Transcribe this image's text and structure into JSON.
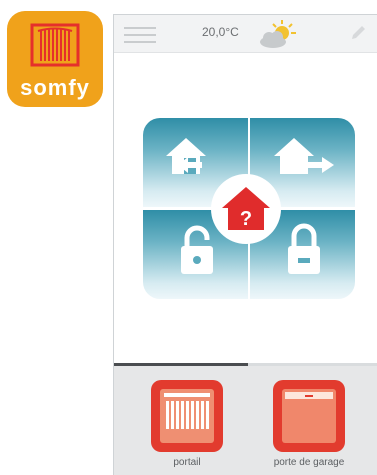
{
  "app": {
    "brand": "somfy",
    "brand_color": "#f0a21b"
  },
  "header": {
    "temperature": "20,0°C",
    "weather_icon": "partly-cloudy-sun-icon"
  },
  "control_pad": {
    "quadrants": [
      {
        "name": "leave-home",
        "icon": "house-arrow-left-icon"
      },
      {
        "name": "come-home",
        "icon": "house-arrow-right-icon"
      },
      {
        "name": "unlocked",
        "icon": "unlocked-padlock-icon"
      },
      {
        "name": "locked",
        "icon": "locked-padlock-icon"
      }
    ],
    "center_symbol": "?",
    "accent_color": "#e02c2c"
  },
  "devices": [
    {
      "label": "portail",
      "icon": "gate-icon"
    },
    {
      "label": "porte de garage",
      "icon": "garage-door-icon"
    }
  ],
  "colors": {
    "device_red": "#e23b2e",
    "pad_blue": "#2f8ea7"
  }
}
